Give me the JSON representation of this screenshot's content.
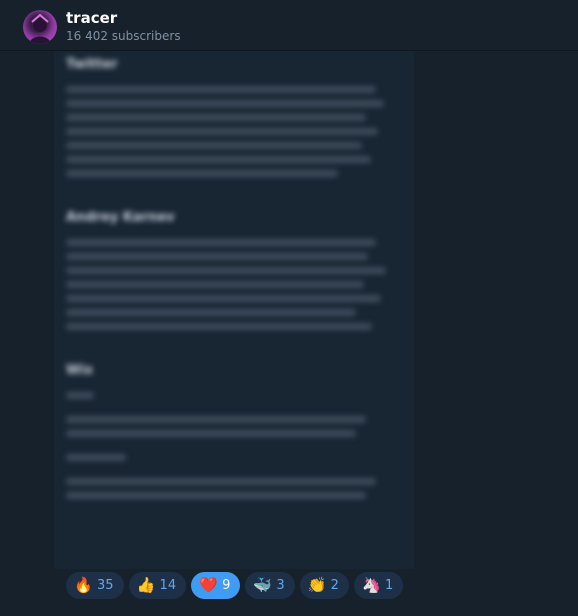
{
  "channel": {
    "title": "tracer",
    "subscribers": "16 402 subscribers"
  },
  "post": {
    "blurred_headings": [
      "Twitter",
      "Andrey Karnev",
      "Wix"
    ]
  },
  "reactions": [
    {
      "emoji": "🔥",
      "name": "fire",
      "count": "35",
      "selected": false
    },
    {
      "emoji": "👍",
      "name": "thumbs-up",
      "count": "14",
      "selected": false
    },
    {
      "emoji": "❤️",
      "name": "heart",
      "count": "9",
      "selected": true
    },
    {
      "emoji": "🐳",
      "name": "whale",
      "count": "3",
      "selected": false
    },
    {
      "emoji": "👏",
      "name": "clap",
      "count": "2",
      "selected": false
    },
    {
      "emoji": "🦄",
      "name": "unicorn",
      "count": "1",
      "selected": false
    }
  ],
  "colors": {
    "background": "#17212b",
    "reaction_chip": "#1e3047",
    "reaction_selected": "#3e9cf5",
    "subtitle": "#7f91a4"
  }
}
